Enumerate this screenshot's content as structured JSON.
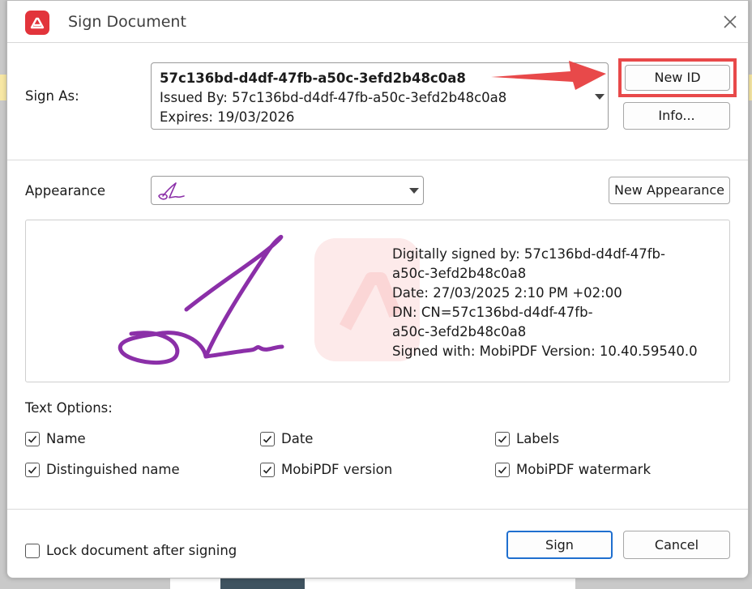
{
  "dialog": {
    "title": "Sign Document",
    "close_icon": "close-icon",
    "app_icon": "mobipdf-logo-icon"
  },
  "sign_as": {
    "label": "Sign As:",
    "id_name": "57c136bd-d4df-47fb-a50c-3efd2b48c0a8",
    "issued_by": "Issued By: 57c136bd-d4df-47fb-a50c-3efd2b48c0a8",
    "expires": "Expires: 19/03/2026",
    "new_id_button": "New ID",
    "info_button": "Info..."
  },
  "appearance": {
    "label": "Appearance",
    "new_appearance_button": "New Appearance"
  },
  "preview": {
    "lines": [
      "Digitally signed by: 57c136bd-d4df-47fb-",
      "a50c-3efd2b48c0a8",
      "Date: 27/03/2025 2:10 PM +02:00",
      "DN: CN=57c136bd-d4df-47fb-",
      "a50c-3efd2b48c0a8",
      "Signed with: MobiPDF Version: 10.40.59540.0"
    ]
  },
  "text_options": {
    "label": "Text Options:",
    "items": [
      {
        "label": "Name",
        "checked": true
      },
      {
        "label": "Date",
        "checked": true
      },
      {
        "label": "Labels",
        "checked": true
      },
      {
        "label": "Distinguished name",
        "checked": true
      },
      {
        "label": "MobiPDF version",
        "checked": true
      },
      {
        "label": "MobiPDF watermark",
        "checked": true
      }
    ]
  },
  "footer": {
    "lock_label": "Lock document after signing",
    "lock_checked": false,
    "sign_button": "Sign",
    "cancel_button": "Cancel"
  },
  "colors": {
    "signature": "#8b2fa8",
    "highlight": "#e8494a",
    "brand": "#e2343b",
    "primary_border": "#1f6fcf"
  }
}
